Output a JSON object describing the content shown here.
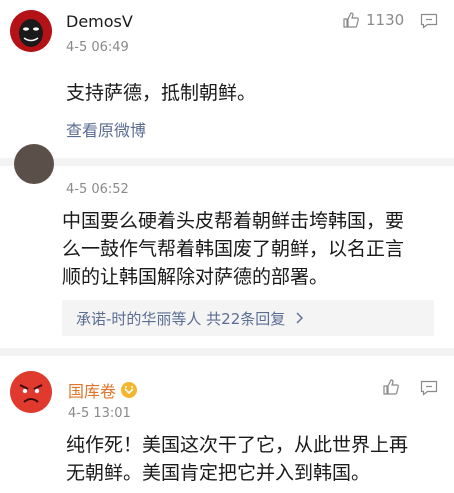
{
  "comments": [
    {
      "username": "DemosV",
      "time": "4-5 06:49",
      "likes": "1130",
      "text": "支持萨德，抵制朝鲜。",
      "link": "查看原微博"
    },
    {
      "time": "4-5 06:52",
      "text_lines": [
        "中国要么硬着头皮帮着朝鲜击垮韩国，要",
        "么一鼓作气帮着韩国废了朝鲜，以名正言",
        "顺的让韩国解除对萨德的部署。"
      ],
      "replies": "承诺-时的华丽等人  共22条回复"
    },
    {
      "username": "国库卷",
      "time": "4-5 13:01",
      "text_lines": [
        "纯作死！美国这次干了它，从此世界上再",
        "无朝鲜。美国肯定把它并入到韩国。"
      ]
    }
  ],
  "colors": {
    "link": "#5b6d93",
    "username_orange": "#e0742a",
    "separator": "#f3f3f3"
  },
  "icons": [
    "thumbs-up-icon",
    "comment-icon",
    "chevron-right-icon",
    "vip-badge-icon"
  ]
}
